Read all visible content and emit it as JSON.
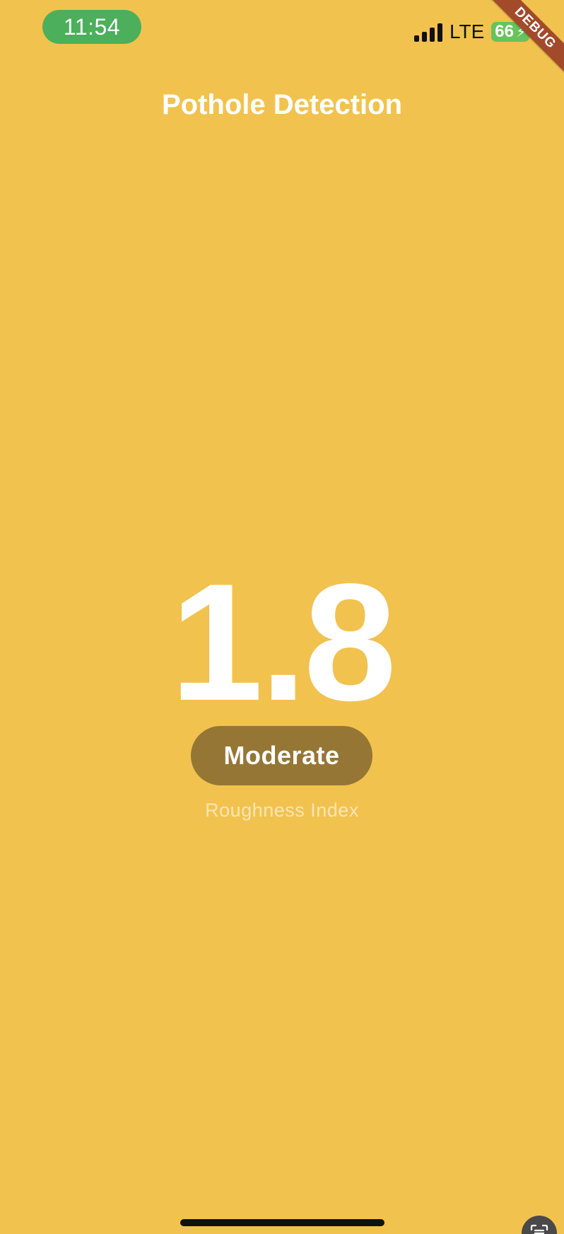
{
  "status_bar": {
    "time": "11:54",
    "network": "LTE",
    "battery_level": "66"
  },
  "debug_banner": {
    "label": "DEBUG"
  },
  "header": {
    "title": "Pothole Detection"
  },
  "reading": {
    "value": "1.8",
    "severity": "Moderate",
    "metric_label": "Roughness Index"
  },
  "colors": {
    "background": "#F2C24F",
    "severity_pill": "#957634",
    "time_pill": "#4CAF5C",
    "battery": "#67C35A",
    "debug_ribbon": "#A34A2B"
  },
  "icons": {
    "signal": "cellular-signal-icon",
    "battery": "battery-charging-icon",
    "scan": "scan-text-icon"
  }
}
